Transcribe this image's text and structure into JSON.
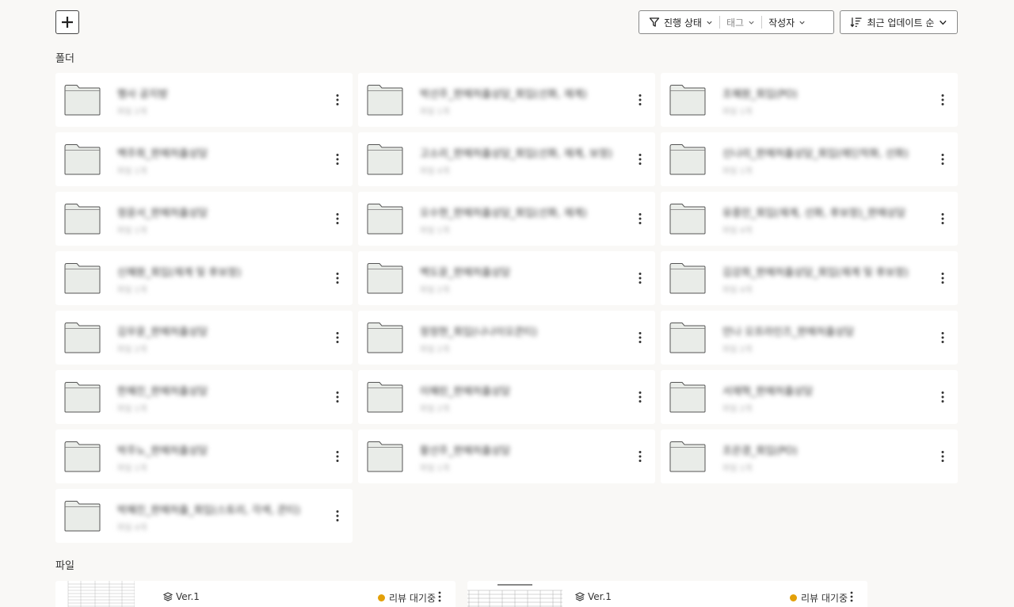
{
  "toolbar": {
    "add_icon": "plus-icon",
    "filter": {
      "status_label": "진행 상태",
      "tag_label": "태그",
      "author_label": "작성자"
    },
    "sort_label": "최근 업데이트 순"
  },
  "folders_section": {
    "title": "폴더",
    "items": [
      {
        "name": "행사 공지방",
        "sub": "파일 2개"
      },
      {
        "name": "박선주_판매처출상담_회입(선화, 재계)",
        "sub": "파일 1개"
      },
      {
        "name": "조혜원_회입(PO)",
        "sub": "파일 1개"
      },
      {
        "name": "백주희_판매처출상담",
        "sub": "파일 1개"
      },
      {
        "name": "고소리_판매처출상담_회입(선화, 재계, 보정)",
        "sub": "파일 4개"
      },
      {
        "name": "신나리_판매처출상담_회입(에딘작화, 선화)",
        "sub": "파일 1개"
      },
      {
        "name": "정윤서_판매처출상담",
        "sub": "파일 1개"
      },
      {
        "name": "오수현_판매처출상담_회입(선화, 재계)",
        "sub": "파일 1개"
      },
      {
        "name": "유종민_회입(재계, 선화, 후보정)_판매상담",
        "sub": "파일 4개"
      },
      {
        "name": "신혜원_회입(재계 및 후보정)",
        "sub": "파일 1개"
      },
      {
        "name": "백도윤_판매처출상담",
        "sub": "파일 2개"
      },
      {
        "name": "김강희_판매처출상담_회입(재계 및 후보정)",
        "sub": "파일 4개"
      },
      {
        "name": "김우윤_판매처출상담",
        "sub": "파일 2개"
      },
      {
        "name": "정정현_회입(나나이오콘티)",
        "sub": "파일 2개"
      },
      {
        "name": "안나 오프라인즈_판매처출상담",
        "sub": "파일 2개"
      },
      {
        "name": "한혜진_판매처출상담",
        "sub": "파일 1개"
      },
      {
        "name": "이혜린_판매처출상담",
        "sub": "파일 2개"
      },
      {
        "name": "서재혁_판매처출상담",
        "sub": "파일 2개"
      },
      {
        "name": "박주노_판매처출상담",
        "sub": "파일 1개"
      },
      {
        "name": "황선주_판매처출상담",
        "sub": "파일 1개"
      },
      {
        "name": "조은경_회입(PO)",
        "sub": "파일 1개"
      },
      {
        "name": "박혜진_판매처출_회입(스토리, 각색, 콘티)",
        "sub": "파일 4개"
      }
    ]
  },
  "files_section": {
    "title": "파일",
    "items": [
      {
        "version": "Ver.1",
        "status": "리뷰 대기중",
        "status_color": "#e3a008"
      },
      {
        "version": "Ver.1",
        "status": "리뷰 대기중",
        "status_color": "#e3a008"
      }
    ]
  }
}
